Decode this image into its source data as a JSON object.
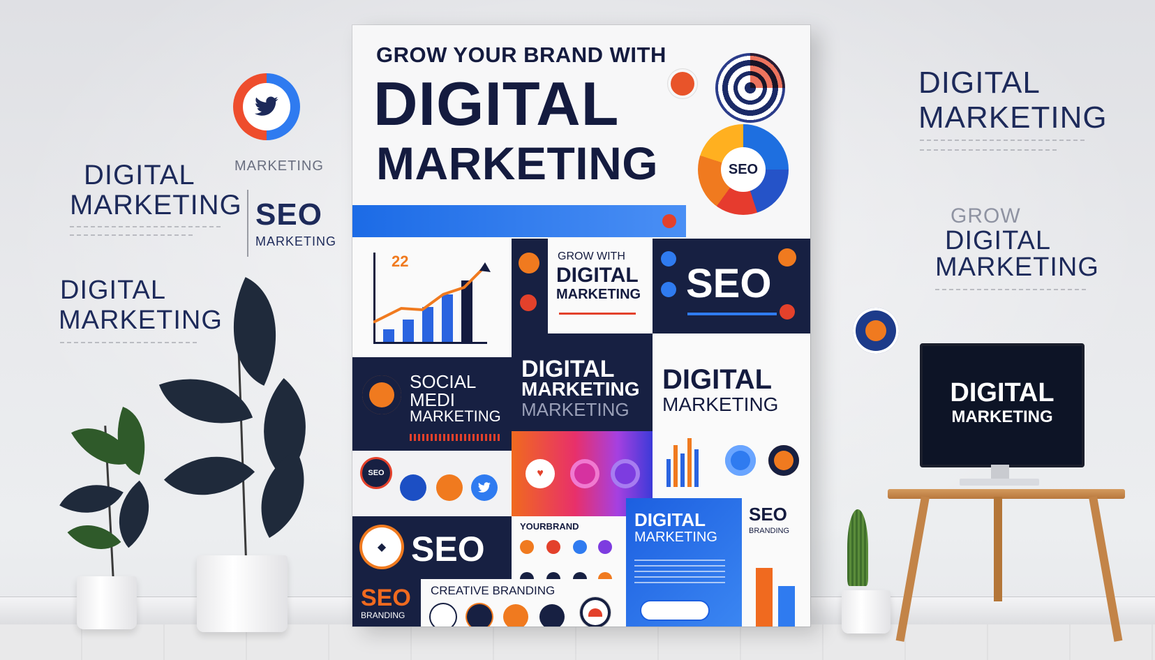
{
  "left_wall": {
    "marketing_small": "MARKETING",
    "digital_1": "DIGITAL",
    "marketing_1": "MARKETING",
    "seo": "SEO",
    "seo_marketing": "MARKETING",
    "digital_2": "DIGITAL",
    "marketing_2": "MARKETING"
  },
  "right_wall": {
    "digital_1": "DIGITAL",
    "marketing_1": "MARKETING",
    "grow": "GROW",
    "digital_2": "DIGITAL",
    "marketing_2": "MARKETING",
    "monitor_line1": "DIGITAL",
    "monitor_line2": "MARKETING"
  },
  "poster": {
    "headline_small": "GROW YOUR BRAND WITH",
    "headline_line1": "DIGITAL",
    "headline_line2": "MARKETING",
    "donut_label": "SEO",
    "tile_grow_small": "GROW WITH",
    "tile_grow_digital": "DIGITAL",
    "tile_grow_marketing": "MARKETING",
    "tile_seo_big": "SEO",
    "tile_social_1": "SOCIAL",
    "tile_social_2": "MEDI",
    "tile_social_3": "MARKETING",
    "tile_dm_center_1": "DIGITAL",
    "tile_dm_center_2": "MARKETING",
    "tile_dm_center_3": "MARKETING",
    "tile_dm_right_1": "DIGITAL",
    "tile_dm_right_2": "MARKETING",
    "seo_badge_small": "SEO",
    "tile_seo_logo": "SEO",
    "tile_yourbrand": "YOURBRAND",
    "tile_dm_blue_1": "DIGITAL",
    "tile_dm_blue_2": "MARKETING",
    "tile_seo_branding_1": "SEO",
    "tile_seo_branding_2": "BRANDING",
    "tile_seo_orange": "SEO",
    "tile_seo_orange_sub": "BRANDING",
    "tile_creative": "CREATIVE BRANDING",
    "chart_number": "22"
  },
  "colors": {
    "navy": "#172042",
    "blue": "#1c6be6",
    "orange": "#f07a1f",
    "red": "#e3412b"
  }
}
